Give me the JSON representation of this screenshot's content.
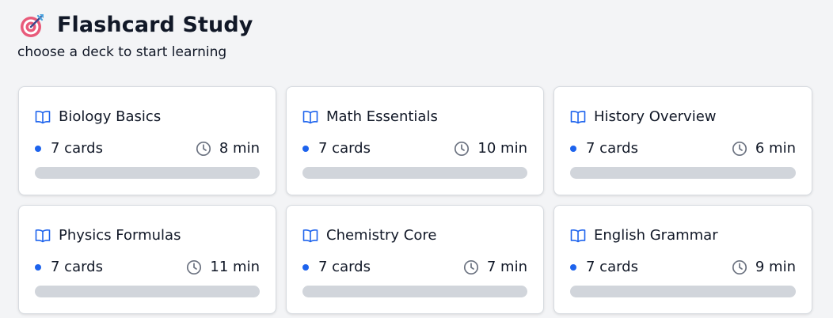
{
  "header": {
    "title": "Flashcard Study",
    "subtitle": "choose a deck to start learning",
    "icon": "target-icon"
  },
  "colors": {
    "accent": "#1d63ed",
    "progress_track": "#d1d5db"
  },
  "decks": [
    {
      "title": "Biology Basics",
      "cards": "7 cards",
      "duration": "8 min",
      "progress": 0
    },
    {
      "title": "Math Essentials",
      "cards": "7 cards",
      "duration": "10 min",
      "progress": 0
    },
    {
      "title": "History Overview",
      "cards": "7 cards",
      "duration": "6 min",
      "progress": 0
    },
    {
      "title": "Physics Formulas",
      "cards": "7 cards",
      "duration": "11 min",
      "progress": 0
    },
    {
      "title": "Chemistry Core",
      "cards": "7 cards",
      "duration": "7 min",
      "progress": 0
    },
    {
      "title": "English Grammar",
      "cards": "7 cards",
      "duration": "9 min",
      "progress": 0
    }
  ]
}
